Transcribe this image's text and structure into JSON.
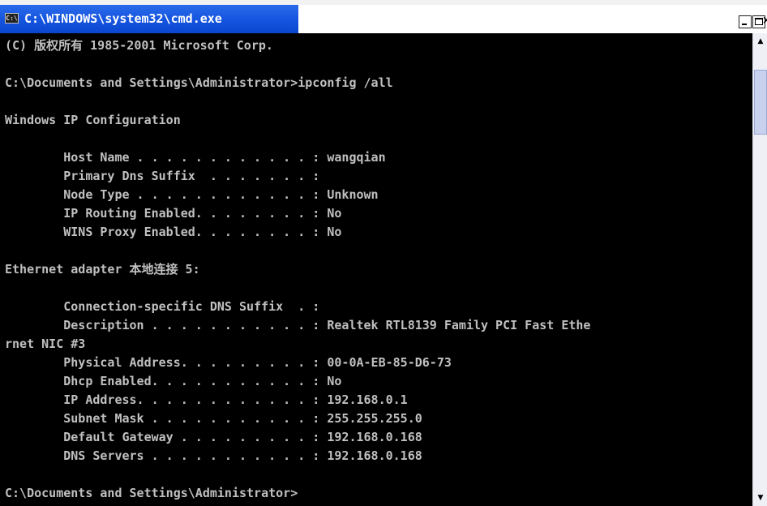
{
  "window": {
    "title": "C:\\WINDOWS\\system32\\cmd.exe",
    "icon_glyph": "C:\\",
    "minimize_glyph": "minimize-icon",
    "maximize_glyph": "maximize-icon",
    "close_glyph": "×"
  },
  "console": {
    "lines": [
      "(C) 版权所有 1985-2001 Microsoft Corp.",
      "",
      "C:\\Documents and Settings\\Administrator>ipconfig /all",
      "",
      "Windows IP Configuration",
      "",
      "        Host Name . . . . . . . . . . . . : wangqian",
      "        Primary Dns Suffix  . . . . . . . :",
      "        Node Type . . . . . . . . . . . . : Unknown",
      "        IP Routing Enabled. . . . . . . . : No",
      "        WINS Proxy Enabled. . . . . . . . : No",
      "",
      "Ethernet adapter 本地连接 5:",
      "",
      "        Connection-specific DNS Suffix  . :",
      "        Description . . . . . . . . . . . : Realtek RTL8139 Family PCI Fast Ethe",
      "rnet NIC #3",
      "        Physical Address. . . . . . . . . : 00-0A-EB-85-D6-73",
      "        Dhcp Enabled. . . . . . . . . . . : No",
      "        IP Address. . . . . . . . . . . . : 192.168.0.1",
      "        Subnet Mask . . . . . . . . . . . : 255.255.255.0",
      "        Default Gateway . . . . . . . . . : 192.168.0.168",
      "        DNS Servers . . . . . . . . . . . : 192.168.0.168",
      "",
      "C:\\Documents and Settings\\Administrator>"
    ]
  },
  "scrollbar": {
    "up_glyph": "▲",
    "down_glyph": "▼"
  },
  "colors": {
    "console_background": "#000000",
    "console_text": "#c0c0c0",
    "title_active": "#1656e0"
  }
}
